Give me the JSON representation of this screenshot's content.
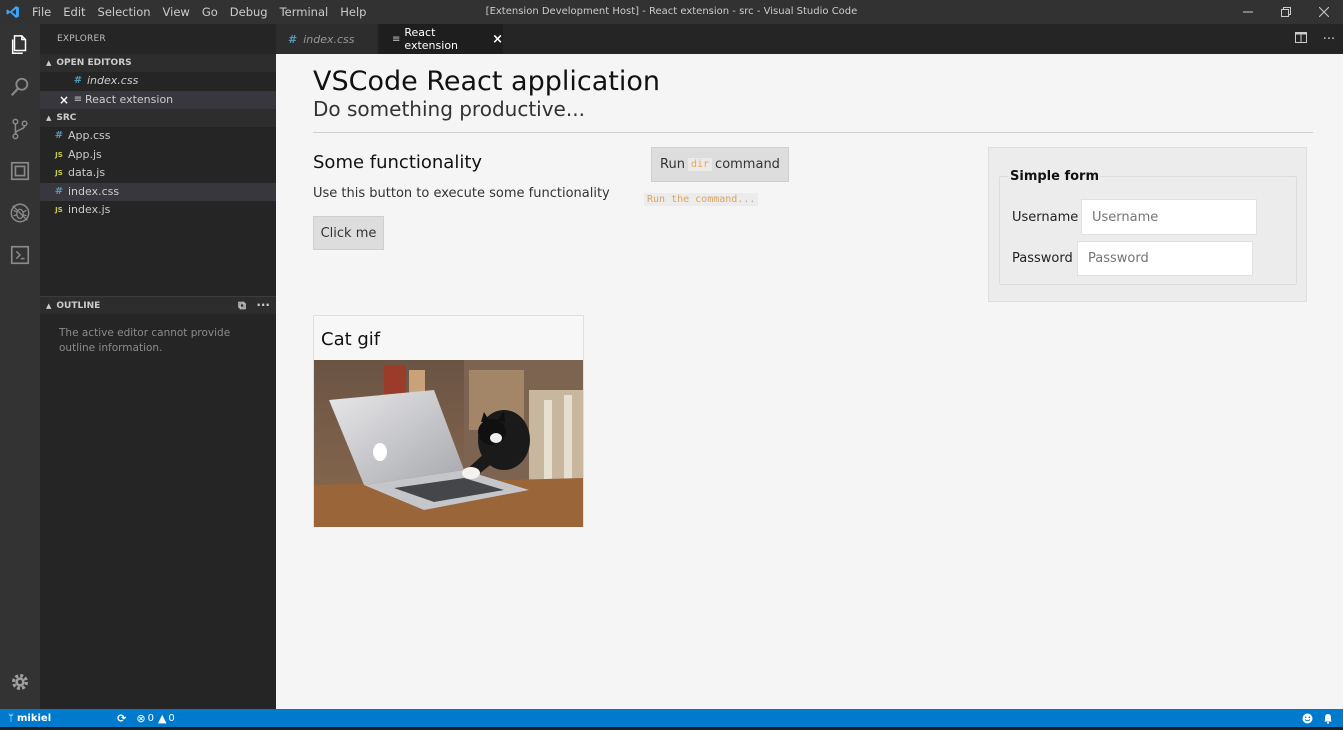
{
  "window": {
    "title": "[Extension Development Host] - React extension - src - Visual Studio Code",
    "menu": [
      "File",
      "Edit",
      "Selection",
      "View",
      "Go",
      "Debug",
      "Terminal",
      "Help"
    ]
  },
  "sidebar": {
    "title": "EXPLORER",
    "open_editors": {
      "header": "OPEN EDITORS",
      "items": [
        {
          "name": "index.css",
          "icon": "#"
        },
        {
          "name": "React extension",
          "close": "×"
        }
      ]
    },
    "src": {
      "header": "SRC",
      "files": [
        {
          "name": "App.css",
          "icon": "#"
        },
        {
          "name": "App.js",
          "icon": "JS"
        },
        {
          "name": "data.js",
          "icon": "JS"
        },
        {
          "name": "index.css",
          "icon": "#"
        },
        {
          "name": "index.js",
          "icon": "JS"
        }
      ]
    },
    "outline": {
      "header": "OUTLINE",
      "message": "The active editor cannot provide outline information."
    }
  },
  "tabs": [
    {
      "label": "index.css",
      "icon": "#"
    },
    {
      "label": "React extension",
      "close": "×"
    }
  ],
  "webview": {
    "title": "VSCode React application",
    "subtitle": "Do something productive...",
    "functionality": {
      "title": "Some functionality",
      "description": "Use this button to execute some functionality",
      "button": "Click me"
    },
    "run": {
      "prefix": "Run",
      "code": "dir",
      "suffix": "command",
      "note": "Run the command..."
    },
    "form": {
      "legend": "Simple form",
      "username_label": "Username",
      "username_placeholder": "Username",
      "password_label": "Password",
      "password_placeholder": "Password"
    },
    "card": {
      "title": "Cat gif"
    }
  },
  "statusbar": {
    "branch": "mikiel",
    "errors": "0",
    "warnings": "0"
  },
  "colors": {
    "accent": "#007acc",
    "activitybar": "#333333",
    "sidebar": "#252526"
  }
}
